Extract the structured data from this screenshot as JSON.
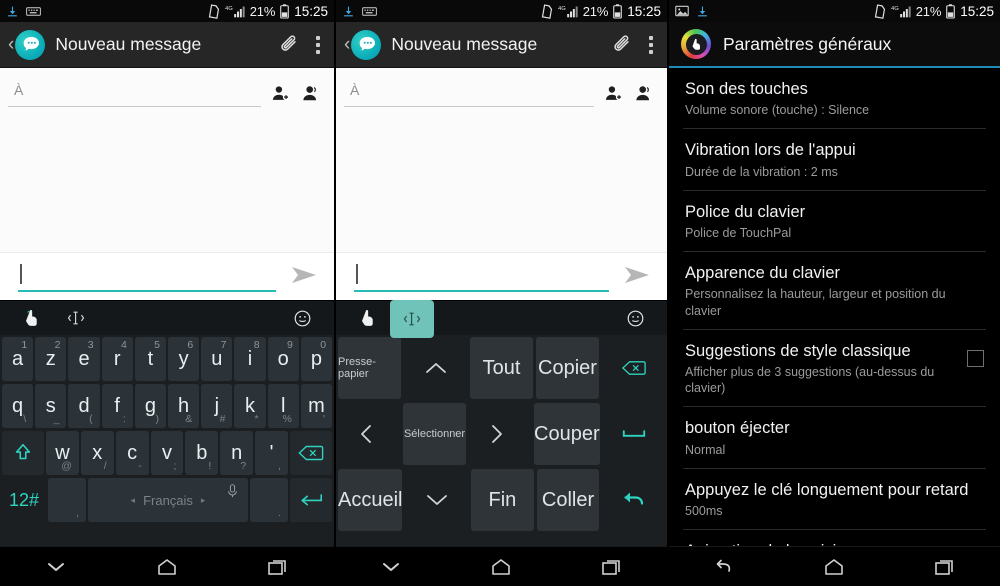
{
  "status_bar": {
    "battery_percent": "21%",
    "time": "15:25",
    "network": "4G",
    "icons_left_p1": [
      "download-icon",
      "keyboard-icon"
    ],
    "icons_left_p3": [
      "image-icon",
      "download-icon"
    ]
  },
  "panel1": {
    "appbar": {
      "title": "Nouveau message",
      "back": "‹",
      "attach_icon": "paperclip-icon",
      "overflow_icon": "overflow-menu-icon"
    },
    "compose": {
      "to_label": "À",
      "contact_add_icon": "add-contact-icon",
      "contacts_icon": "contacts-icon",
      "message_value": "",
      "send_icon": "send-icon"
    },
    "keyboard": {
      "toolbar": {
        "hand_icon": "hand-cursor-icon",
        "cursor_icon": "text-cursor-icon",
        "emoji_icon": "emoji-smiley-icon"
      },
      "row1": [
        {
          "main": "a",
          "sup": "1"
        },
        {
          "main": "z",
          "sup": "2"
        },
        {
          "main": "e",
          "sup": "3"
        },
        {
          "main": "r",
          "sup": "4"
        },
        {
          "main": "t",
          "sup": "5"
        },
        {
          "main": "y",
          "sup": "6"
        },
        {
          "main": "u",
          "sup": "7"
        },
        {
          "main": "i",
          "sup": "8"
        },
        {
          "main": "o",
          "sup": "9"
        },
        {
          "main": "p",
          "sup": "0"
        }
      ],
      "row2": [
        {
          "main": "q",
          "sub": "\\"
        },
        {
          "main": "s",
          "sub": "_"
        },
        {
          "main": "d",
          "sub": "("
        },
        {
          "main": "f",
          "sub": ":"
        },
        {
          "main": "g",
          "sub": ")"
        },
        {
          "main": "h",
          "sub": "&"
        },
        {
          "main": "j",
          "sub": "#"
        },
        {
          "main": "k",
          "sub": "*"
        },
        {
          "main": "l",
          "sub": "%"
        },
        {
          "main": "m",
          "sub": "'"
        }
      ],
      "row3": [
        {
          "main": "w",
          "sub": "@"
        },
        {
          "main": "x",
          "sub": "/"
        },
        {
          "main": "c",
          "sub": "-"
        },
        {
          "main": "v",
          "sub": ";"
        },
        {
          "main": "b",
          "sub": "!"
        },
        {
          "main": "n",
          "sub": "?"
        },
        {
          "main": "'",
          "sub": ","
        }
      ],
      "shift_icon": "shift-icon",
      "backspace_icon": "backspace-icon",
      "row4": {
        "numsym": "12#",
        "comma": ",",
        "space_label": "Français",
        "space_prev": "◂",
        "space_next": "▸",
        "mic_icon": "microphone-icon",
        "period": ".",
        "enter_icon": "enter-icon"
      }
    },
    "navbar": {
      "back_icon": "chevron-down-icon",
      "home_icon": "home-icon",
      "recents_icon": "recents-icon"
    }
  },
  "panel2": {
    "appbar": {
      "title": "Nouveau message",
      "back": "‹",
      "attach_icon": "paperclip-icon",
      "overflow_icon": "overflow-menu-icon"
    },
    "compose": {
      "to_label": "À",
      "contact_add_icon": "add-contact-icon",
      "contacts_icon": "contacts-icon",
      "message_value": "",
      "send_icon": "send-icon"
    },
    "edit_keyboard": {
      "toolbar": {
        "hand_icon": "hand-cursor-icon",
        "cursor_icon": "text-cursor-icon",
        "emoji_icon": "emoji-smiley-icon",
        "active": "text-cursor-icon"
      },
      "rows": [
        [
          {
            "label": "Presse-papier",
            "kind": "small"
          },
          {
            "label": "▲",
            "kind": "nav"
          },
          {
            "label": "Tout",
            "kind": "normal"
          },
          {
            "label": "Copier",
            "kind": "normal"
          },
          {
            "label": "backspace-icon",
            "kind": "teal"
          }
        ],
        [
          {
            "label": "‹",
            "kind": "nav-blank"
          },
          {
            "label": "Sélectionner",
            "kind": "small"
          },
          {
            "label": "›",
            "kind": "nav"
          },
          {
            "label": "Couper",
            "kind": "normal"
          },
          {
            "label": "space-icon",
            "kind": "teal"
          }
        ],
        [
          {
            "label": "Accueil",
            "kind": "normal"
          },
          {
            "label": "▼",
            "kind": "nav"
          },
          {
            "label": "Fin",
            "kind": "normal"
          },
          {
            "label": "Coller",
            "kind": "normal"
          },
          {
            "label": "undo-icon",
            "kind": "teal"
          }
        ]
      ]
    },
    "navbar": {
      "back_icon": "chevron-down-icon",
      "home_icon": "home-icon",
      "recents_icon": "recents-icon"
    }
  },
  "panel3": {
    "appbar": {
      "title": "Paramètres généraux",
      "logo_icon": "touchpal-logo-icon"
    },
    "settings": [
      {
        "title": "Son des touches",
        "subtitle": "Volume sonore (touche) : Silence",
        "control": "none"
      },
      {
        "title": "Vibration lors de l'appui",
        "subtitle": "Durée de la vibration : 2 ms",
        "control": "none"
      },
      {
        "title": "Police du clavier",
        "subtitle": "Police de TouchPal",
        "control": "none"
      },
      {
        "title": "Apparence du clavier",
        "subtitle": "Personnalisez la hauteur, largeur et position du clavier",
        "control": "none"
      },
      {
        "title": "Suggestions de style classique",
        "subtitle": "Afficher plus de 3 suggestions (au-dessus du clavier)",
        "control": "checkbox",
        "checked": false
      },
      {
        "title": "bouton éjecter",
        "subtitle": "Normal",
        "control": "none"
      },
      {
        "title": "Appuyez le clé longuement pour retard",
        "subtitle": "500ms",
        "control": "none"
      },
      {
        "title": "Animation de la saisie",
        "subtitle": "",
        "control": "toggle"
      }
    ],
    "navbar": {
      "back_icon": "back-arrow-icon",
      "home_icon": "home-icon",
      "recents_icon": "recents-icon"
    }
  },
  "colors": {
    "accent_teal": "#2fd3c0",
    "app_teal": "#14b3bd",
    "settings_divider": "#1f8ab5",
    "key_bg": "#2c3338",
    "keyboard_bg": "#1b1f22"
  }
}
